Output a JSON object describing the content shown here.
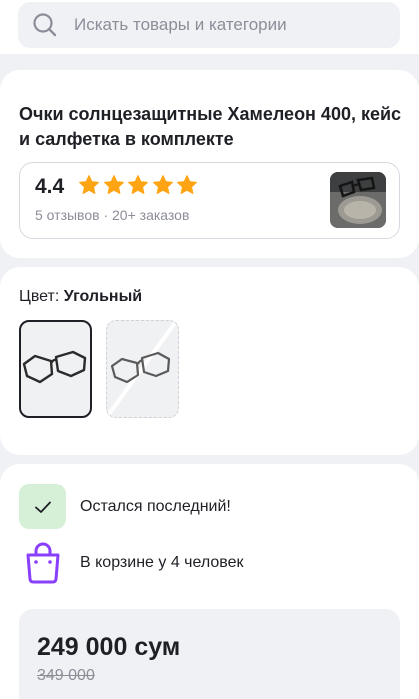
{
  "search": {
    "placeholder": "Искать товары и категории",
    "icon": "search-icon"
  },
  "product": {
    "title": "Очки солнцезащитные Хамелеон 400, кейс и салфетка в комплекте",
    "rating": {
      "value": "4.4",
      "stars": 5,
      "reviews": "5 отзывов",
      "separator": "·",
      "orders": "20+ заказов"
    }
  },
  "color": {
    "label": "Цвет:",
    "selected": "Угольный",
    "options_count": 2
  },
  "stock": {
    "text": "Остался последний!"
  },
  "cart": {
    "text": "В корзине у 4 человек"
  },
  "price": {
    "current": "249 000 сум",
    "old": "349 000"
  },
  "colors": {
    "star": "#ffa412",
    "check_bg": "#d6f0d8",
    "check": "#1f2026",
    "bag": "#8a3ffc",
    "text_primary": "#1f2026",
    "text_secondary": "#8b8e99"
  }
}
